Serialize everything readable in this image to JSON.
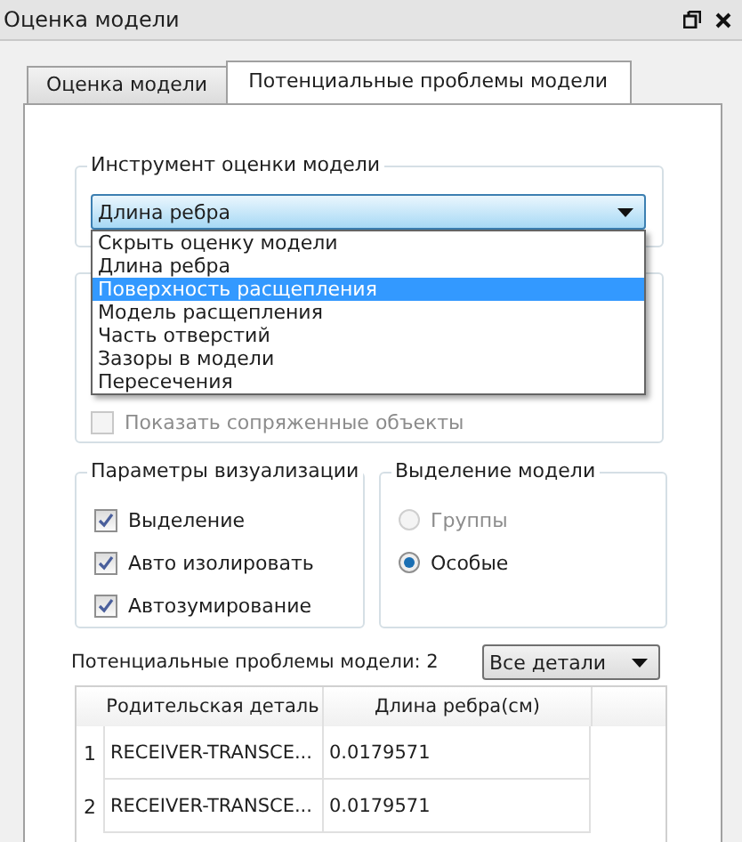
{
  "window": {
    "title": "Оценка модели"
  },
  "tabs": [
    {
      "label": "Оценка модели",
      "selected": false
    },
    {
      "label": "Потенциальные проблемы модели",
      "selected": true
    }
  ],
  "tool_group": {
    "title": "Инструмент оценки модели",
    "combo": {
      "value": "Длина ребра",
      "expanded": true
    },
    "options": [
      {
        "label": "Скрыть оценку модели",
        "selected": false
      },
      {
        "label": "Длина ребра",
        "selected": false
      },
      {
        "label": "Поверхность расщепления",
        "selected": true
      },
      {
        "label": "Модель расщепления",
        "selected": false
      },
      {
        "label": "Часть отверстий",
        "selected": false
      },
      {
        "label": "Зазоры в модели",
        "selected": false
      },
      {
        "label": "Пересечения",
        "selected": false
      }
    ]
  },
  "options_group": {
    "checkbox": {
      "label": "Показать сопряженные объекты",
      "checked": false,
      "disabled": true
    }
  },
  "visualization": {
    "title": "Параметры визуализации",
    "checkboxes": [
      {
        "label": "Выделение",
        "checked": true
      },
      {
        "label": "Авто изолировать",
        "checked": true
      },
      {
        "label": "Автозумирование",
        "checked": true
      }
    ]
  },
  "selection": {
    "title": "Выделение модели",
    "radios": [
      {
        "label": "Группы",
        "selected": false,
        "disabled": true
      },
      {
        "label": "Особые",
        "selected": true,
        "disabled": false
      }
    ]
  },
  "problems": {
    "label": "Потенциальные проблемы модели: 2",
    "filter": "Все детали"
  },
  "table": {
    "columns": [
      "Родительская деталь",
      "Длина ребра(см)"
    ],
    "rows": [
      {
        "index": "1",
        "cells": [
          "RECEIVER-TRANSCE...",
          "0.0179571"
        ]
      },
      {
        "index": "2",
        "cells": [
          "RECEIVER-TRANSCE...",
          "0.0179571"
        ]
      }
    ]
  }
}
